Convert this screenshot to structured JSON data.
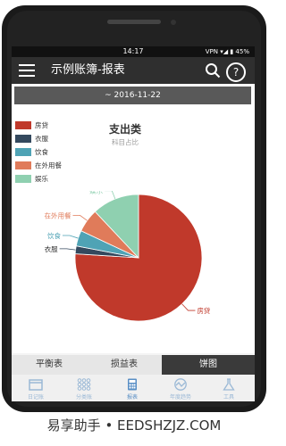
{
  "status_bar": {
    "time": "14:17",
    "right": "VPN ▾◢ ▮ 45%"
  },
  "app_bar": {
    "title": "示例账簿-报表",
    "help_symbol": "?"
  },
  "date_range": "~ 2016-11-22",
  "chart_data": {
    "type": "pie",
    "title": "支出类",
    "subtitle": "科目占比",
    "legend": [
      "房贷",
      "衣服",
      "饮食",
      "在外用餐",
      "娱乐"
    ],
    "colors": [
      "#c0392b",
      "#34495e",
      "#4fa3b5",
      "#e07b5a",
      "#8fd0b0"
    ],
    "values": [
      76,
      2,
      4,
      6,
      12
    ]
  },
  "tabs": [
    {
      "label": "平衡表"
    },
    {
      "label": "损益表"
    },
    {
      "label": "饼图"
    }
  ],
  "bottom_nav": [
    {
      "label": "日记账",
      "icon": "calendar-icon"
    },
    {
      "label": "分类账",
      "icon": "grid-icon"
    },
    {
      "label": "报表",
      "icon": "calculator-icon"
    },
    {
      "label": "年度趋势",
      "icon": "trend-icon"
    },
    {
      "label": "工具",
      "icon": "flask-icon"
    }
  ],
  "brand": "易享助手 • EEDSHZJZ.COM"
}
